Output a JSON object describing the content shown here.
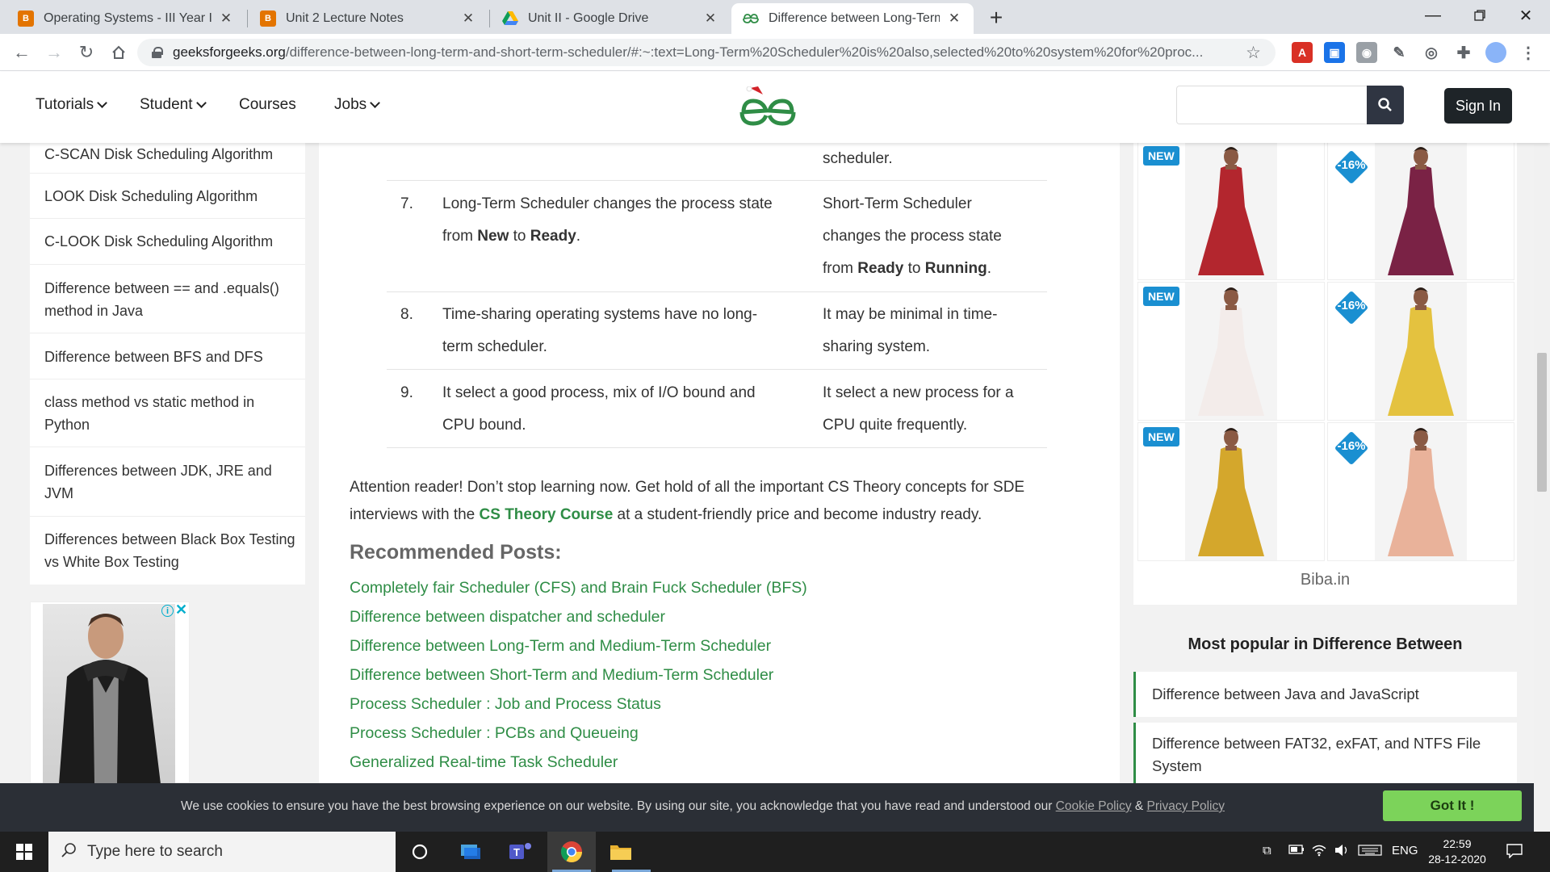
{
  "browser": {
    "tabs": [
      {
        "title": "Operating Systems - III Year IT (B...",
        "icon_color": "#e37400",
        "active": false
      },
      {
        "title": "Unit 2 Lecture Notes",
        "icon_color": "#e37400",
        "active": false
      },
      {
        "title": "Unit II - Google Drive",
        "icon_color": "#1a73e8",
        "active": false
      },
      {
        "title": "Difference between Long-Term a...",
        "icon_color": "#2f8d46",
        "active": true
      }
    ],
    "url_domain": "geeksforgeeks.org",
    "url_path": "/difference-between-long-term-and-short-term-scheduler/#:~:text=Long-Term%20Scheduler%20is%20also,selected%20to%20system%20for%20proc..."
  },
  "site": {
    "nav": [
      {
        "label": "Tutorials",
        "has_dropdown": true
      },
      {
        "label": "Student",
        "has_dropdown": true
      },
      {
        "label": "Courses",
        "has_dropdown": false
      },
      {
        "label": "Jobs",
        "has_dropdown": true
      }
    ],
    "sign_in": "Sign In",
    "brand_color": "#2f8d46"
  },
  "sidebar_left": {
    "links": [
      "C-SCAN Disk Scheduling Algorithm",
      "LOOK Disk Scheduling Algorithm",
      "C-LOOK Disk Scheduling Algorithm",
      "Difference between == and .equals() method in Java",
      "Difference between BFS and DFS",
      "class method vs static method in Python",
      "Differences between JDK, JRE and JVM",
      "Differences between Black Box Testing vs White Box Testing"
    ]
  },
  "table": {
    "prev_tail": "scheduler.",
    "rows": [
      {
        "num": "7.",
        "long": [
          "Long-Term Scheduler changes the process state",
          "from ",
          "New",
          " to ",
          "Ready",
          "."
        ],
        "short": [
          "Short-Term Scheduler",
          "changes the process state",
          "from ",
          "Ready",
          " to ",
          "Running",
          "."
        ]
      },
      {
        "num": "8.",
        "long": [
          "Time-sharing operating systems have no long-",
          "term scheduler."
        ],
        "short": [
          "It may be minimal in time-",
          "sharing system."
        ]
      },
      {
        "num": "9.",
        "long": [
          "It select a good process, mix of I/O bound and",
          "CPU bound."
        ],
        "short": [
          "It select a new process for a",
          "CPU quite frequently."
        ]
      }
    ]
  },
  "attention": {
    "pre": "Attention reader! Don’t stop learning now. Get hold of all the important CS Theory concepts for SDE interviews with the ",
    "link": "CS Theory Course",
    "post": " at a student-friendly price and become industry ready."
  },
  "recommended": {
    "title": "Recommended Posts:",
    "links": [
      "Completely fair Scheduler (CFS) and Brain Fuck Scheduler (BFS)",
      "Difference between dispatcher and scheduler",
      "Difference between Long-Term and Medium-Term Scheduler",
      "Difference between Short-Term and Medium-Term Scheduler",
      "Process Scheduler : Job and Process Status",
      "Process Scheduler : PCBs and Queueing",
      "Generalized Real-time Task Scheduler"
    ]
  },
  "ad_right": {
    "products": [
      {
        "badge": "NEW",
        "dress_color": "#b3262e"
      },
      {
        "badge": "-16%",
        "dress_color": "#7a2245"
      },
      {
        "badge": "NEW",
        "dress_color": "#f3ecea"
      },
      {
        "badge": "-16%",
        "dress_color": "#e4c23f"
      },
      {
        "badge": "NEW",
        "dress_color": "#d4a72c"
      },
      {
        "badge": "-16%",
        "dress_color": "#e9b29a"
      }
    ],
    "brand": "Biba.in"
  },
  "most_popular": {
    "title": "Most popular in Difference Between",
    "items": [
      "Difference between Java and JavaScript",
      "Difference between FAT32, exFAT, and NTFS File System"
    ]
  },
  "cookie": {
    "text": "We use cookies to ensure you have the best browsing experience on our website. By using our site, you acknowledge that you have read and understood our ",
    "cookie_policy": "Cookie Policy",
    "amp": " & ",
    "privacy_policy": "Privacy Policy",
    "button": "Got It !"
  },
  "taskbar": {
    "search_placeholder": "Type here to search",
    "lang": "ENG",
    "time": "22:59",
    "date": "28-12-2020"
  }
}
